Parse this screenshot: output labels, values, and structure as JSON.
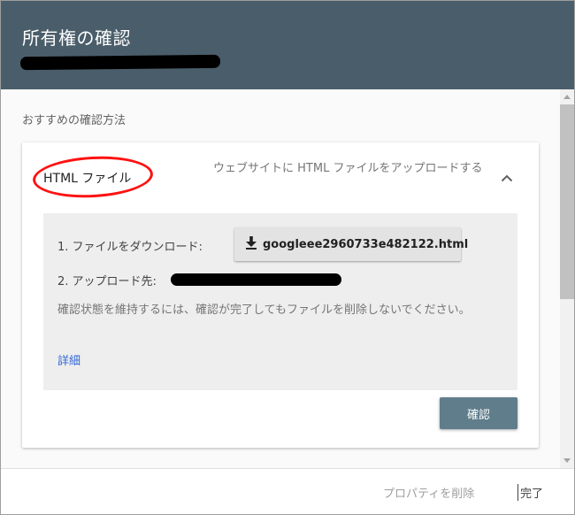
{
  "header": {
    "title": "所有権の確認"
  },
  "section": {
    "label": "おすすめの確認方法"
  },
  "card": {
    "title": "HTML ファイル",
    "description": "ウェブサイトに HTML ファイルをアップロードする",
    "expand_icon": "chevron-up-icon"
  },
  "steps": {
    "download_label": "1. ファイルをダウンロード:",
    "download_icon": "download-icon",
    "download_filename": "googleee2960733e482122.html",
    "upload_label": "2. アップロード先:",
    "note": "確認状態を維持するには、確認が完了してもファイルを削除しないでください。",
    "details_link": "詳細"
  },
  "actions": {
    "verify_label": "確認"
  },
  "footer": {
    "delete_label": "プロパティを削除",
    "done_label": "完了"
  },
  "colors": {
    "header_bg": "#4a5d6a",
    "verify_button": "#607d8b",
    "link": "#3367d6",
    "annotation": "#ff1111"
  }
}
